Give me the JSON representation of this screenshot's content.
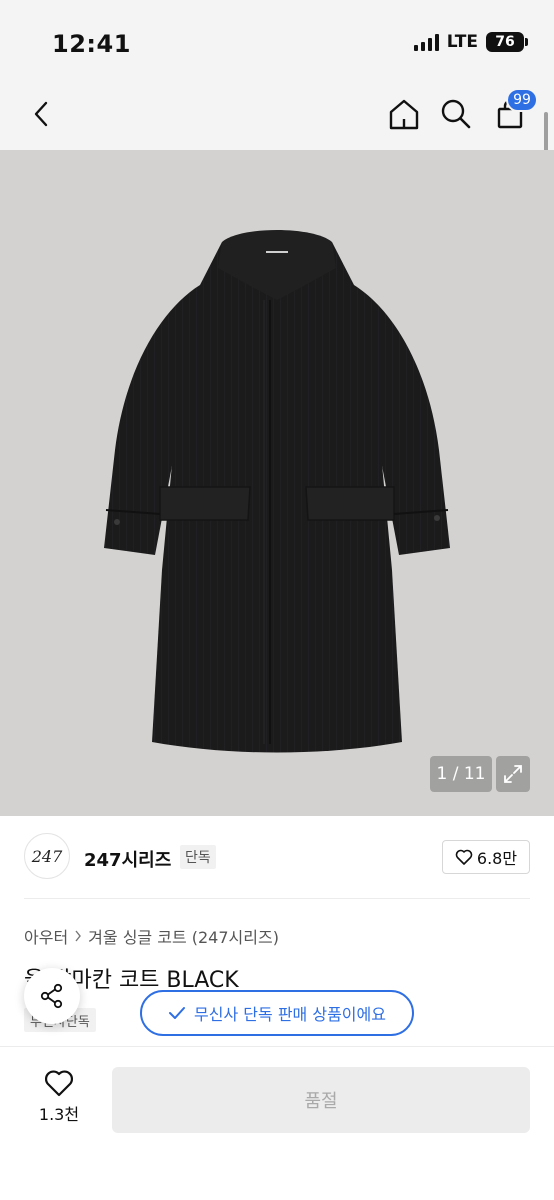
{
  "status_bar": {
    "time": "12:41",
    "network": "LTE",
    "battery": "76"
  },
  "nav": {
    "cart_count": "99"
  },
  "gallery": {
    "counter": "1 / 11"
  },
  "brand": {
    "logo_text": "247",
    "name": "247시리즈",
    "tag": "단독",
    "like_count": "6.8만"
  },
  "breadcrumb": {
    "category": "아우터",
    "subcategory": "겨울 싱글 코트 (247시리즈)"
  },
  "product": {
    "title": "울 발마칸 코트 BLACK",
    "exclusive_tag": "무신사단독"
  },
  "toast": {
    "text": "무신사 단독 판매 상품이에요"
  },
  "bottom": {
    "wish_count": "1.3천",
    "buy_label": "품절"
  },
  "colors": {
    "accent": "#2f6fe4",
    "coat": "#1b1b1c",
    "backdrop": "#d3d2d0"
  }
}
